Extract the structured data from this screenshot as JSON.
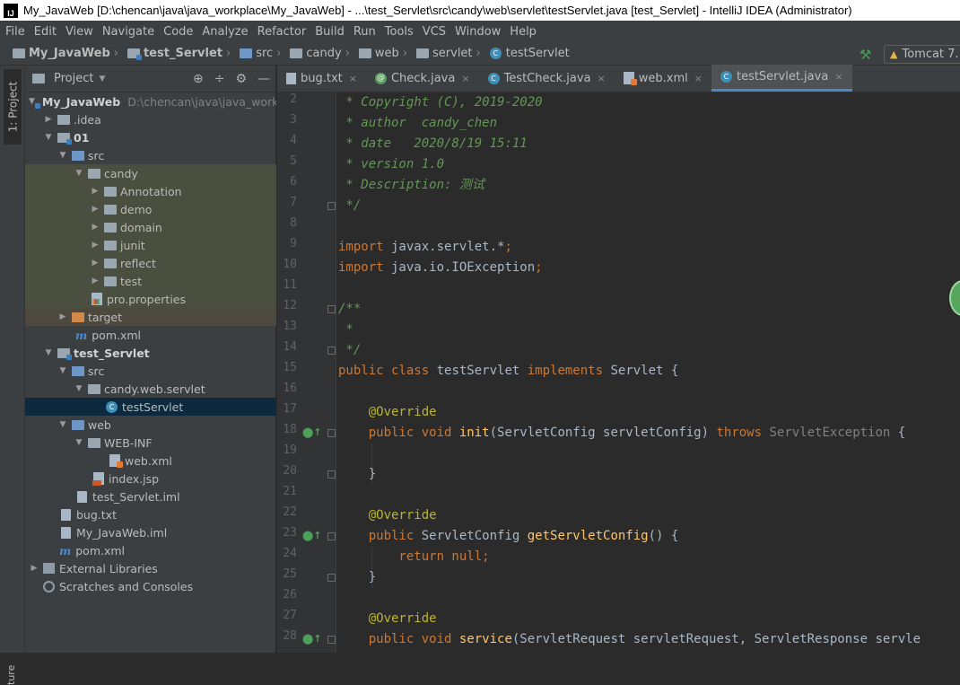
{
  "window": {
    "title": "My_JavaWeb [D:\\chencan\\java\\java_workplace\\My_JavaWeb] - ...\\test_Servlet\\src\\candy\\web\\servlet\\testServlet.java [test_Servlet] - IntelliJ IDEA (Administrator)",
    "app_icon": "IJ"
  },
  "menu": [
    "File",
    "Edit",
    "View",
    "Navigate",
    "Code",
    "Analyze",
    "Refactor",
    "Build",
    "Run",
    "Tools",
    "VCS",
    "Window",
    "Help"
  ],
  "breadcrumbs": [
    "My_JavaWeb",
    "test_Servlet",
    "src",
    "candy",
    "web",
    "servlet",
    "testServlet"
  ],
  "run_config": "Tomcat 7.",
  "side_strip": {
    "project_label": "1: Project",
    "bottom_label": "ture"
  },
  "project_panel": {
    "title": "Project",
    "tree": [
      {
        "label": "My_JavaWeb",
        "path": "D:\\chencan\\java\\java_workplace"
      },
      {
        "label": ".idea"
      },
      {
        "label": "01"
      },
      {
        "label": "src"
      },
      {
        "label": "candy"
      },
      {
        "label": "Annotation"
      },
      {
        "label": "demo"
      },
      {
        "label": "domain"
      },
      {
        "label": "junit"
      },
      {
        "label": "reflect"
      },
      {
        "label": "test"
      },
      {
        "label": "pro.properties"
      },
      {
        "label": "target"
      },
      {
        "label": "pom.xml"
      },
      {
        "label": "test_Servlet"
      },
      {
        "label": "src"
      },
      {
        "label": "candy.web.servlet"
      },
      {
        "label": "testServlet"
      },
      {
        "label": "web"
      },
      {
        "label": "WEB-INF"
      },
      {
        "label": "web.xml"
      },
      {
        "label": "index.jsp"
      },
      {
        "label": "test_Servlet.iml"
      },
      {
        "label": "bug.txt"
      },
      {
        "label": "My_JavaWeb.iml"
      },
      {
        "label": "pom.xml"
      },
      {
        "label": "External Libraries"
      },
      {
        "label": "Scratches and Consoles"
      }
    ]
  },
  "tabs": [
    "bug.txt",
    "Check.java",
    "TestCheck.java",
    "web.xml",
    "testServlet.java"
  ],
  "editor": {
    "line_numbers": [
      "2",
      "3",
      "4",
      "5",
      "6",
      "7",
      "8",
      "9",
      "10",
      "11",
      "12",
      "13",
      "14",
      "15",
      "16",
      "17",
      "18",
      "19",
      "20",
      "21",
      "22",
      "23",
      "24",
      "25",
      "26",
      "27",
      "28"
    ],
    "lines": {
      "l2": " * Copyright (C), 2019-2020",
      "l3": " * author  candy_chen",
      "l4": " * date   2020/8/19 15:11",
      "l5": " * version 1.0",
      "l6": " * Description: 测试",
      "l7": " */",
      "l9a": "import",
      "l9b": " javax.servlet.*",
      "l9c": ";",
      "l10a": "import",
      "l10b": " java.io.IOException",
      "l10c": ";",
      "l12": "/**",
      "l13": " *",
      "l14": " */",
      "l15a": "public class",
      "l15b": " testServlet ",
      "l15c": "implements",
      "l15d": " Servlet {",
      "l17": "    @Override",
      "l18a": "    public void",
      "l18b": " init",
      "l18c": "(ServletConfig servletConfig) ",
      "l18d": "throws",
      "l18e": " ServletException",
      "l18f": " {",
      "l20": "    }",
      "l22": "    @Override",
      "l23a": "    public",
      "l23b": " ServletConfig ",
      "l23c": "getServletConfig",
      "l23d": "() {",
      "l24a": "        return null",
      "l24b": ";",
      "l25": "    }",
      "l27": "    @Override",
      "l28a": "    public void",
      "l28b": " service",
      "l28c": "(ServletRequest servletRequest, ServletResponse servle"
    }
  }
}
